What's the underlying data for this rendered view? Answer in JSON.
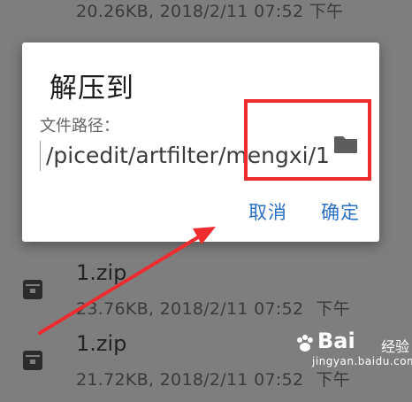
{
  "file_list": {
    "top_meta": "20.26KB, 2018/2/11 07:52 下午",
    "items": [
      {
        "name": "1.zip",
        "size_date": "23.76KB, 2018/2/11 07:52",
        "suffix": "下午"
      },
      {
        "name": "1.zip",
        "size_date": "21.72KB, 2018/2/11 07:52",
        "suffix": "下午"
      }
    ]
  },
  "dialog": {
    "title": "解压到",
    "path_label": "文件路径：",
    "path_value": "/picedit/artfilter/mengxi/1",
    "cancel_label": "取消",
    "confirm_label": "确定"
  },
  "watermark": {
    "brand": "Bai",
    "brand_cn": "经验",
    "domain": "jingyan.baidu.com"
  },
  "colors": {
    "accent": "#2a6fc6",
    "highlight": "#ee2b2f",
    "overlay": "#7e7e7e"
  }
}
